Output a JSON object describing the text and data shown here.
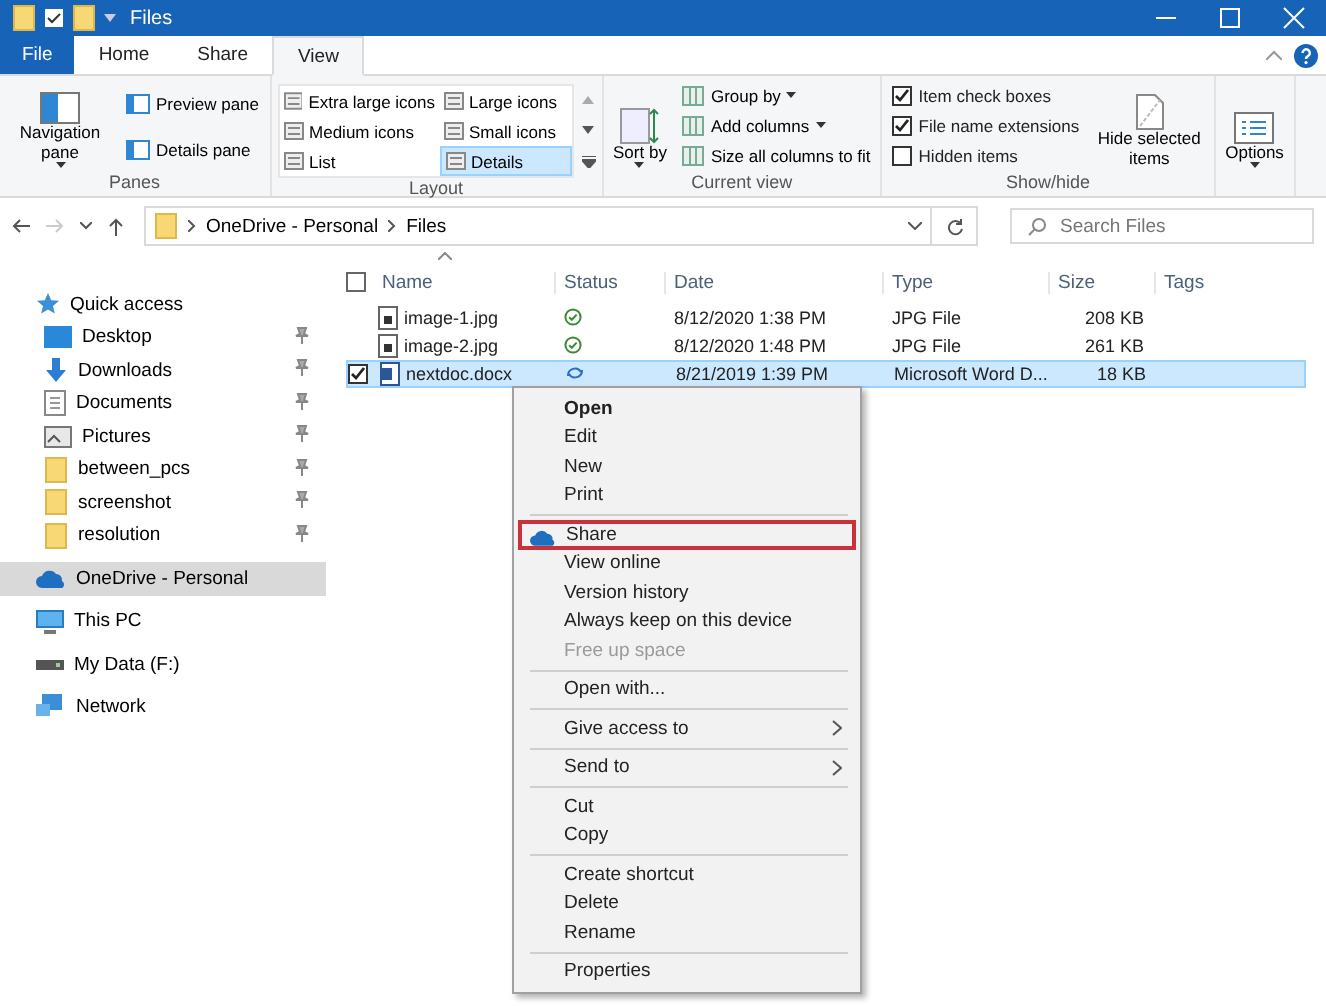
{
  "window": {
    "title": "Files"
  },
  "ribbon": {
    "tabs": [
      {
        "label": "File",
        "kind": "file",
        "selected": false
      },
      {
        "label": "Home",
        "kind": "tab",
        "selected": false
      },
      {
        "label": "Share",
        "kind": "tab",
        "selected": false
      },
      {
        "label": "View",
        "kind": "tab",
        "selected": true
      }
    ],
    "panes": {
      "label": "Panes",
      "navigation": "Navigation pane",
      "items": [
        "Preview pane",
        "Details pane"
      ]
    },
    "layout": {
      "label": "Layout",
      "items": [
        {
          "label": "Extra large icons",
          "selected": false
        },
        {
          "label": "Large icons",
          "selected": false
        },
        {
          "label": "Medium icons",
          "selected": false
        },
        {
          "label": "Small icons",
          "selected": false
        },
        {
          "label": "List",
          "selected": false
        },
        {
          "label": "Details",
          "selected": true
        }
      ]
    },
    "current_view": {
      "label": "Current view",
      "sort": "Sort by",
      "items": [
        {
          "label": "Group by",
          "dropdown": true
        },
        {
          "label": "Add columns",
          "dropdown": true
        },
        {
          "label": "Size all columns to fit",
          "dropdown": false
        }
      ]
    },
    "show_hide": {
      "label": "Show/hide",
      "checkboxes": [
        {
          "label": "Item check boxes",
          "checked": true
        },
        {
          "label": "File name extensions",
          "checked": true
        },
        {
          "label": "Hidden items",
          "checked": false
        }
      ],
      "hide_selected": "Hide selected items"
    },
    "options": {
      "label": "Options"
    }
  },
  "address": {
    "path": [
      "OneDrive - Personal",
      "Files"
    ],
    "search": {
      "placeholder": "Search Files"
    }
  },
  "nav": [
    {
      "label": "Quick access",
      "kind": "star",
      "selected": false,
      "children": [
        {
          "label": "Desktop",
          "kind": "desktop",
          "pinned": true
        },
        {
          "label": "Downloads",
          "kind": "download",
          "pinned": true
        },
        {
          "label": "Documents",
          "kind": "document",
          "pinned": true
        },
        {
          "label": "Pictures",
          "kind": "picture",
          "pinned": true
        },
        {
          "label": "between_pcs",
          "kind": "folder",
          "pinned": true
        },
        {
          "label": "screenshot",
          "kind": "folder",
          "pinned": true
        },
        {
          "label": "resolution",
          "kind": "folder",
          "pinned": true
        }
      ]
    },
    {
      "label": "OneDrive - Personal",
      "kind": "cloud",
      "selected": true
    },
    {
      "label": "This PC",
      "kind": "pc",
      "selected": false
    },
    {
      "label": "My Data (F:)",
      "kind": "drive",
      "selected": false
    },
    {
      "label": "Network",
      "kind": "network",
      "selected": false
    }
  ],
  "table": {
    "select_all": {
      "checked": false
    },
    "columns": [
      "Name",
      "Status",
      "Date",
      "Type",
      "Size",
      "Tags"
    ],
    "rows": [
      {
        "name": "image-1.jpg",
        "kind": "image",
        "status": {
          "kind": "synced"
        },
        "date": "8/12/2020 1:38 PM",
        "type": "JPG File",
        "size": "208 KB",
        "checked": false,
        "selected": false
      },
      {
        "name": "image-2.jpg",
        "kind": "image",
        "status": {
          "kind": "synced"
        },
        "date": "8/12/2020 1:48 PM",
        "type": "JPG File",
        "size": "261 KB",
        "checked": false,
        "selected": false
      },
      {
        "name": "nextdoc.docx",
        "kind": "word",
        "status": {
          "kind": "syncing"
        },
        "date": "8/21/2019 1:39 PM",
        "type": "Microsoft Word D...",
        "size": "18 KB",
        "checked": true,
        "selected": true
      }
    ]
  },
  "context_menu": {
    "groups": [
      [
        {
          "label": "Open",
          "bold": true
        },
        {
          "label": "Edit"
        },
        {
          "label": "New"
        },
        {
          "label": "Print"
        }
      ],
      [
        {
          "label": "Share",
          "kind": "cloud",
          "highlighted": true
        },
        {
          "label": "View online"
        },
        {
          "label": "Version history"
        },
        {
          "label": "Always keep on this device"
        },
        {
          "label": "Free up space",
          "disabled": true
        }
      ],
      [
        {
          "label": "Open with..."
        }
      ],
      [
        {
          "label": "Give access to",
          "submenu": true
        }
      ],
      [
        {
          "label": "Send to",
          "submenu": true
        }
      ],
      [
        {
          "label": "Cut"
        },
        {
          "label": "Copy"
        }
      ],
      [
        {
          "label": "Create shortcut"
        },
        {
          "label": "Delete"
        },
        {
          "label": "Rename"
        }
      ],
      [
        {
          "label": "Properties"
        }
      ]
    ]
  }
}
